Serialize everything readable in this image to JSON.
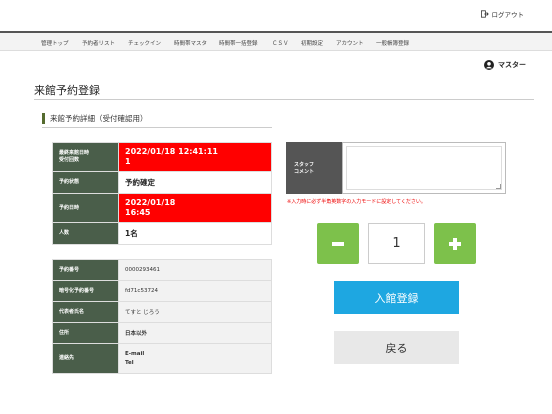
{
  "header": {
    "logout_label": "ログアウト",
    "user_name": "マスター"
  },
  "nav": [
    "管理トップ",
    "予約者リスト",
    "チェックイン",
    "時間帯マスタ",
    "時間帯一括登録",
    "ＣＳＶ",
    "初期設定",
    "アカウント",
    "一般帳簿登録"
  ],
  "page": {
    "title": "来館予約登録",
    "section_title": "来館予約詳細（受付確認用）"
  },
  "details_top": [
    {
      "label": [
        "最終来館日時",
        "受付回数"
      ],
      "value": [
        "2022/01/18 12:41:11",
        "1"
      ],
      "style": "red"
    },
    {
      "label": [
        "予約状態"
      ],
      "value": [
        "予約確定"
      ],
      "style": "plain"
    },
    {
      "label": [
        "予約日時"
      ],
      "value": [
        "2022/01/18",
        "16:45"
      ],
      "style": "red"
    },
    {
      "label": [
        "人数"
      ],
      "value": [
        "1名"
      ],
      "style": "plain"
    }
  ],
  "details_bottom": [
    {
      "label": [
        "予約番号"
      ],
      "value": [
        "0000293461"
      ],
      "bold": false
    },
    {
      "label": [
        "暗号化予約番号"
      ],
      "value": [
        "fd71c53724"
      ],
      "bold": false
    },
    {
      "label": [
        "代表者氏名"
      ],
      "value": [
        "てすと じろう"
      ],
      "bold": false
    },
    {
      "label": [
        "住所"
      ],
      "value": [
        "日本以外"
      ],
      "bold": true
    },
    {
      "label": [
        "連絡先"
      ],
      "value": [
        "E-mail",
        "Tel"
      ],
      "bold": true
    }
  ],
  "memo": {
    "label": [
      "スタッフ",
      "コメント"
    ],
    "value": "",
    "note": "※入力時に必ず半角英数字の入力モードに設定してください。"
  },
  "stepper": {
    "quantity": "1"
  },
  "buttons": {
    "register": "入館登録",
    "back": "戻る"
  },
  "colors": {
    "accent_green": "#7dc14b",
    "primary_blue": "#1ea7e1",
    "alert_red": "#ff0000",
    "label_dark": "#4a5e4a"
  }
}
